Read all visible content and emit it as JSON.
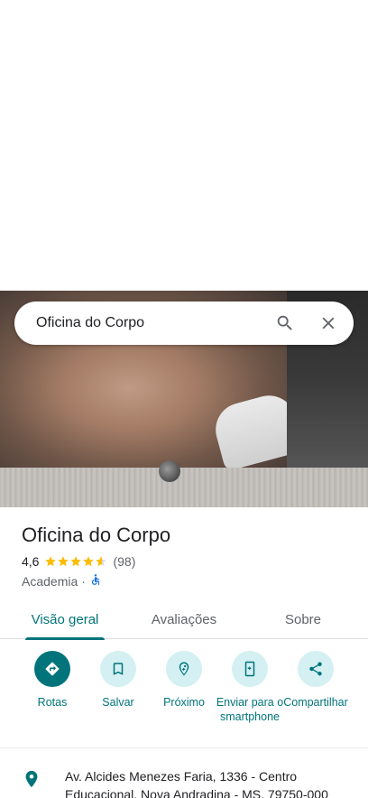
{
  "search": {
    "query": "Oficina do Corpo"
  },
  "place": {
    "name": "Oficina do Corpo",
    "rating": "4,6",
    "stars": 4.6,
    "review_count": "(98)",
    "category": "Academia",
    "separator": "·"
  },
  "tabs": [
    {
      "label": "Visão geral",
      "active": true
    },
    {
      "label": "Avaliações",
      "active": false
    },
    {
      "label": "Sobre",
      "active": false
    }
  ],
  "actions": [
    {
      "label": "Rotas",
      "icon": "directions-icon"
    },
    {
      "label": "Salvar",
      "icon": "bookmark-icon"
    },
    {
      "label": "Próximo",
      "icon": "nearby-icon"
    },
    {
      "label": "Enviar para o smartphone",
      "icon": "send-to-phone-icon"
    },
    {
      "label": "Compartilhar",
      "icon": "share-icon"
    }
  ],
  "address": {
    "text": "Av. Alcides Menezes Faria, 1336 - Centro Educacional, Nova Andradina - MS, 79750-000"
  },
  "colors": {
    "accent": "#00747a",
    "accent_light": "#d4f0f3",
    "star": "#fbbc04"
  }
}
